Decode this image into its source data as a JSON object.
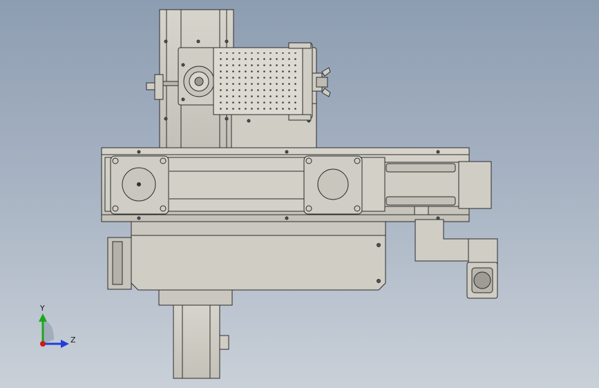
{
  "window": {
    "title": ""
  },
  "triad": {
    "y_label": "Y",
    "z_label": "Z"
  },
  "colors": {
    "background_top": "#8d9db1",
    "background_bottom": "#c9d0d8",
    "part_fill": "#cfcdc4",
    "part_shadow": "#b9b7ae",
    "outline": "#2b2b2b",
    "y_axis": "#1aa81a",
    "z_axis": "#1f3fd8",
    "origin": "#d01818"
  }
}
